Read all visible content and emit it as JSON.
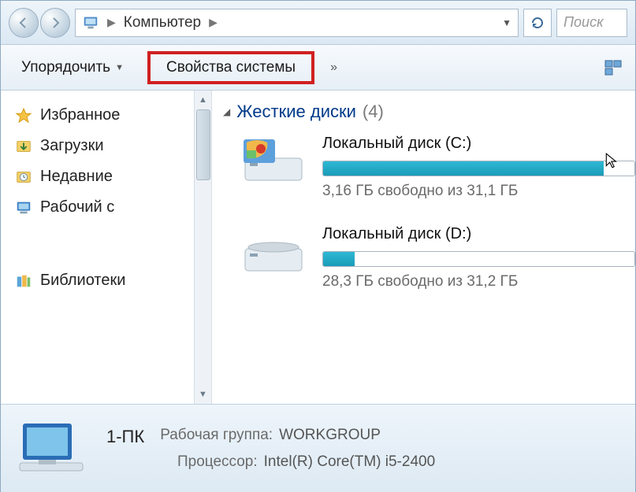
{
  "addressbar": {
    "location": "Компьютер",
    "search_placeholder": "Поиск"
  },
  "toolbar": {
    "organize": "Упорядочить",
    "system_properties": "Свойства системы",
    "more": "»"
  },
  "sidebar": {
    "favorites": "Избранное",
    "downloads": "Загрузки",
    "recent": "Недавние",
    "desktop": "Рабочий с",
    "libraries": "Библиотеки"
  },
  "content": {
    "section_title": "Жесткие диски",
    "section_count": "(4)",
    "drives": [
      {
        "name": "Локальный диск (C:)",
        "free_text": "3,16 ГБ свободно из 31,1 ГБ",
        "fill_pct": 90
      },
      {
        "name": "Локальный диск (D:)",
        "free_text": "28,3 ГБ свободно из 31,2 ГБ",
        "fill_pct": 10
      }
    ]
  },
  "details": {
    "pc_name": "1-ПК",
    "workgroup_label": "Рабочая группа:",
    "workgroup_value": "WORKGROUP",
    "cpu_label": "Процессор:",
    "cpu_value": "Intel(R) Core(TM) i5-2400"
  }
}
